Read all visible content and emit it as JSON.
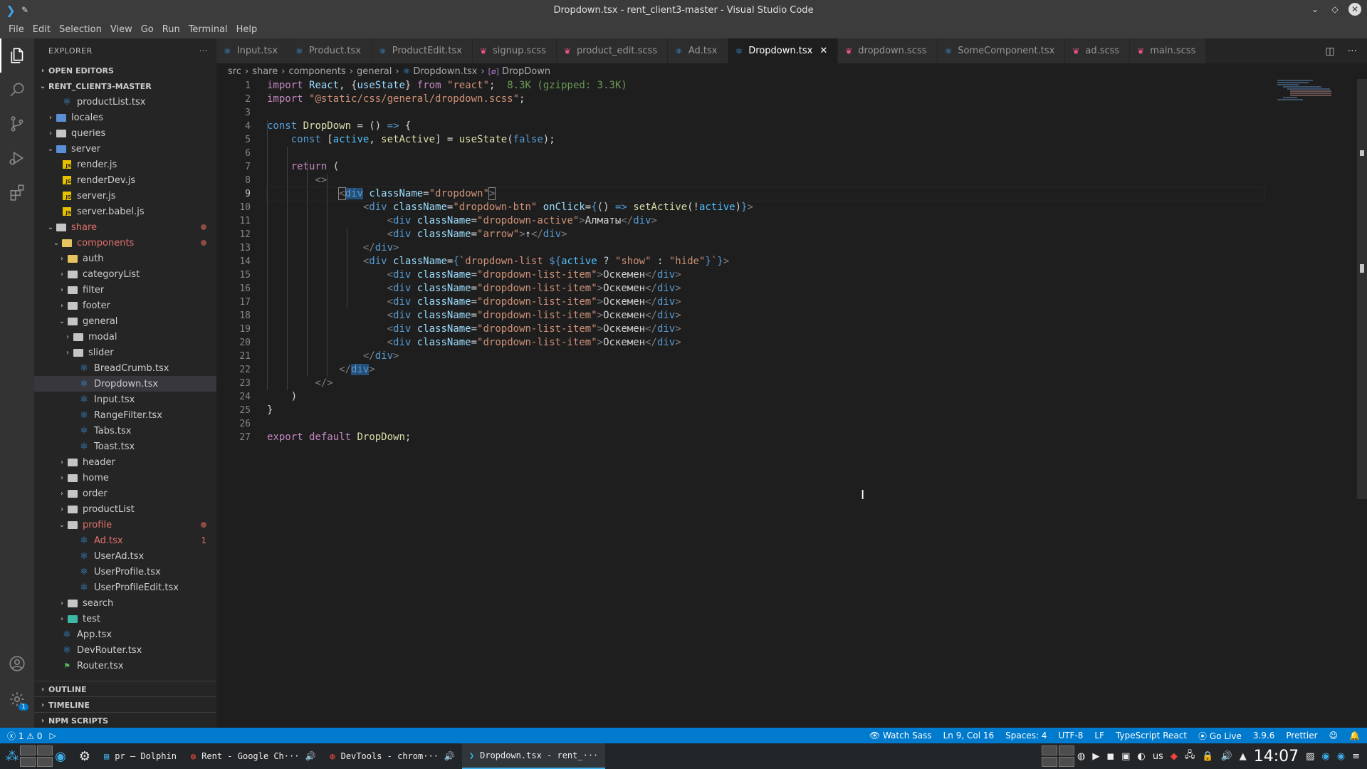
{
  "window": {
    "title": "Dropdown.tsx - rent_client3-master - Visual Studio Code"
  },
  "menu": [
    "File",
    "Edit",
    "Selection",
    "View",
    "Go",
    "Run",
    "Terminal",
    "Help"
  ],
  "sidebar": {
    "title": "EXPLORER",
    "more": "···",
    "open_editors": "OPEN EDITORS",
    "project": "RENT_CLIENT3-MASTER",
    "outline": "OUTLINE",
    "timeline": "TIMELINE",
    "npm": "NPM SCRIPTS",
    "tree": [
      {
        "label": "productList.tsx",
        "kind": "react",
        "depth": 2
      },
      {
        "label": "locales",
        "kind": "folder",
        "depth": 1,
        "state": "closed",
        "color": "blue"
      },
      {
        "label": "queries",
        "kind": "folder",
        "depth": 1,
        "state": "closed"
      },
      {
        "label": "server",
        "kind": "folder",
        "depth": 1,
        "state": "open",
        "color": "blue"
      },
      {
        "label": "render.js",
        "kind": "js",
        "depth": 2
      },
      {
        "label": "renderDev.js",
        "kind": "js",
        "depth": 2
      },
      {
        "label": "server.js",
        "kind": "js",
        "depth": 2
      },
      {
        "label": "server.babel.js",
        "kind": "js",
        "depth": 2
      },
      {
        "label": "share",
        "kind": "folder",
        "depth": 1,
        "state": "open",
        "modified": true,
        "dot": true
      },
      {
        "label": "components",
        "kind": "folder",
        "depth": 2,
        "state": "open",
        "modified": true,
        "dot": true,
        "color": "yellow"
      },
      {
        "label": "auth",
        "kind": "folder",
        "depth": 3,
        "state": "closed",
        "color": "yellow"
      },
      {
        "label": "categoryList",
        "kind": "folder",
        "depth": 3,
        "state": "closed"
      },
      {
        "label": "filter",
        "kind": "folder",
        "depth": 3,
        "state": "closed"
      },
      {
        "label": "footer",
        "kind": "folder",
        "depth": 3,
        "state": "closed"
      },
      {
        "label": "general",
        "kind": "folder",
        "depth": 3,
        "state": "open"
      },
      {
        "label": "modal",
        "kind": "folder",
        "depth": 4,
        "state": "closed"
      },
      {
        "label": "slider",
        "kind": "folder",
        "depth": 4,
        "state": "closed"
      },
      {
        "label": "BreadCrumb.tsx",
        "kind": "react",
        "depth": 5
      },
      {
        "label": "Dropdown.tsx",
        "kind": "react",
        "depth": 5,
        "selected": true
      },
      {
        "label": "Input.tsx",
        "kind": "react",
        "depth": 5
      },
      {
        "label": "RangeFilter.tsx",
        "kind": "react",
        "depth": 5
      },
      {
        "label": "Tabs.tsx",
        "kind": "react",
        "depth": 5
      },
      {
        "label": "Toast.tsx",
        "kind": "react",
        "depth": 5
      },
      {
        "label": "header",
        "kind": "folder",
        "depth": 3,
        "state": "closed"
      },
      {
        "label": "home",
        "kind": "folder",
        "depth": 3,
        "state": "closed"
      },
      {
        "label": "order",
        "kind": "folder",
        "depth": 3,
        "state": "closed"
      },
      {
        "label": "productList",
        "kind": "folder",
        "depth": 3,
        "state": "closed"
      },
      {
        "label": "profile",
        "kind": "folder",
        "depth": 3,
        "state": "open",
        "modified": true,
        "dot": true
      },
      {
        "label": "Ad.tsx",
        "kind": "react",
        "depth": 5,
        "modified": true,
        "count": "1"
      },
      {
        "label": "UserAd.tsx",
        "kind": "react",
        "depth": 5
      },
      {
        "label": "UserProfile.tsx",
        "kind": "react",
        "depth": 5
      },
      {
        "label": "UserProfileEdit.tsx",
        "kind": "react",
        "depth": 5
      },
      {
        "label": "search",
        "kind": "folder",
        "depth": 3,
        "state": "closed"
      },
      {
        "label": "test",
        "kind": "folder",
        "depth": 3,
        "state": "closed",
        "color": "green"
      },
      {
        "label": "App.tsx",
        "kind": "react",
        "depth": 2
      },
      {
        "label": "DevRouter.tsx",
        "kind": "react",
        "depth": 2
      },
      {
        "label": "Router.tsx",
        "kind": "router",
        "depth": 2
      }
    ]
  },
  "tabs": [
    {
      "label": "Input.tsx",
      "type": "react"
    },
    {
      "label": "Product.tsx",
      "type": "react"
    },
    {
      "label": "ProductEdit.tsx",
      "type": "react"
    },
    {
      "label": "signup.scss",
      "type": "scss"
    },
    {
      "label": "product_edit.scss",
      "type": "scss"
    },
    {
      "label": "Ad.tsx",
      "type": "react"
    },
    {
      "label": "Dropdown.tsx",
      "type": "react",
      "active": true
    },
    {
      "label": "dropdown.scss",
      "type": "scss"
    },
    {
      "label": "SomeComponent.tsx",
      "type": "react"
    },
    {
      "label": "ad.scss",
      "type": "scss"
    },
    {
      "label": "main.scss",
      "type": "scss"
    }
  ],
  "breadcrumb": [
    "src",
    "share",
    "components",
    "general",
    "Dropdown.tsx",
    "DropDown"
  ],
  "editor": {
    "line_numbers": [
      "1",
      "2",
      "3",
      "4",
      "5",
      "6",
      "7",
      "8",
      "9",
      "10",
      "11",
      "12",
      "13",
      "14",
      "15",
      "16",
      "17",
      "18",
      "19",
      "20",
      "21",
      "22",
      "23",
      "24",
      "25",
      "26",
      "27"
    ],
    "current_line": 9,
    "import_size_hint": "8.3K (gzipped: 3.3K)",
    "import_path": "\"@static/css/general/dropdown.scss\"",
    "react_path": "\"react\"",
    "component_name": "DropDown",
    "active_text": "Алматы",
    "arrow_text": "↑",
    "list_item_text": "Оскемен",
    "list_items_count": 6
  },
  "status": {
    "errors": "1",
    "warnings": "0",
    "watch_sass": "Watch Sass",
    "position": "Ln 9, Col 16",
    "spaces": "Spaces: 4",
    "encoding": "UTF-8",
    "eol": "LF",
    "language": "TypeScript React",
    "go_live": "Go Live",
    "version": "3.9.6",
    "prettier": "Prettier"
  },
  "taskbar": {
    "tasks": [
      {
        "label": "pr — Dolphin",
        "icon": "dolphin-icon"
      },
      {
        "label": "Rent - Google Ch···",
        "icon": "chrome-icon"
      },
      {
        "label": "DevTools - chrom···",
        "icon": "chrome-icon"
      },
      {
        "label": "Dropdown.tsx - rent_···",
        "icon": "vscode-icon",
        "active": true
      }
    ],
    "keyboard_layout": "us",
    "clock": "14:07"
  },
  "colors": {
    "accent": "#007acc",
    "modified": "#e2706a",
    "react": "#3d9be9",
    "scss": "#f55385"
  }
}
